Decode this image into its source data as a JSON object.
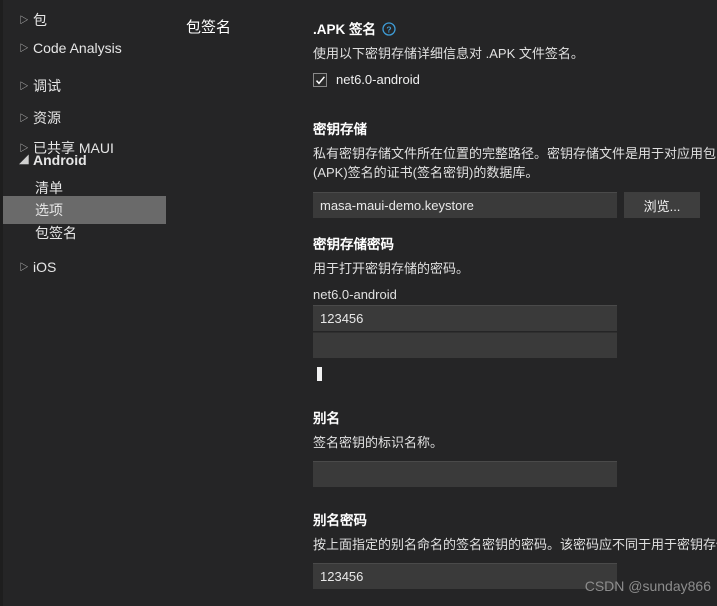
{
  "window": {
    "page_title": "包签名",
    "background_color": "#252526",
    "accent_color": "#3e9cd6",
    "selection_color": "#6a6a6a"
  },
  "sidebar": {
    "items": [
      {
        "label": "包",
        "twisty": "▷",
        "level": 0,
        "selected": false,
        "bold": false,
        "icon": "chevron-right-icon"
      },
      {
        "label": "Code Analysis",
        "twisty": "▷",
        "level": 0,
        "selected": false,
        "bold": false,
        "icon": "chevron-right-icon"
      },
      {
        "label": "调试",
        "twisty": "▷",
        "level": 0,
        "selected": false,
        "bold": false,
        "icon": "chevron-right-icon"
      },
      {
        "label": "资源",
        "twisty": "▷",
        "level": 0,
        "selected": false,
        "bold": false,
        "icon": "chevron-right-icon"
      },
      {
        "label": "已共享 MAUI",
        "twisty": "▷",
        "level": 0,
        "selected": false,
        "bold": false,
        "icon": "chevron-right-icon"
      },
      {
        "label": "Android",
        "twisty": "◢",
        "level": 0,
        "selected": false,
        "bold": true,
        "icon": "chevron-down-icon"
      },
      {
        "label": "清单",
        "twisty": "",
        "level": 1,
        "selected": false,
        "bold": false,
        "icon": ""
      },
      {
        "label": "选项",
        "twisty": "",
        "level": 1,
        "selected": true,
        "bold": false,
        "icon": ""
      },
      {
        "label": "包签名",
        "twisty": "",
        "level": 1,
        "selected": false,
        "bold": false,
        "icon": ""
      },
      {
        "label": "iOS",
        "twisty": "▷",
        "level": 0,
        "selected": false,
        "bold": false,
        "icon": "chevron-right-icon"
      }
    ]
  },
  "main": {
    "apk_signing": {
      "title": ".APK 签名",
      "help_icon": "help-circle-icon",
      "description": "使用以下密钥存储详细信息对 .APK 文件签名。",
      "checkbox": {
        "label": "net6.0-android",
        "checked": true,
        "icon": "checkmark-icon"
      }
    },
    "keystore": {
      "title": "密钥存储",
      "description": "私有密钥存储文件所在位置的完整路径。密钥存储文件是用于对应用包(APK)签名的证书(签名密钥)的数据库。",
      "value": "masa-maui-demo.keystore",
      "placeholder": "",
      "browse_label": "浏览..."
    },
    "keystore_password": {
      "title": "密钥存储密码",
      "description": "用于打开密钥存储的密码。",
      "sub_label": "net6.0-android",
      "value": "123456",
      "second_value": "",
      "placeholder": ""
    },
    "alias": {
      "title": "别名",
      "description": "签名密钥的标识名称。",
      "value": "",
      "placeholder": ""
    },
    "alias_password": {
      "title": "别名密码",
      "description": "按上面指定的别名命名的签名密钥的密码。该密码应不同于用于密钥存储的密码。",
      "value": "123456",
      "placeholder": ""
    }
  },
  "watermark": {
    "text": "CSDN @sunday866"
  }
}
